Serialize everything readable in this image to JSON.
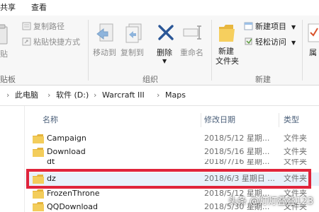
{
  "tabs": [
    "共享",
    "查看"
  ],
  "ribbon": {
    "clipboard": {
      "partial_paste": "贴",
      "copy_path": "复制路径",
      "paste_shortcut": "粘贴快捷方式",
      "group_label_partial": "贴板"
    },
    "organize": {
      "move_to": "移动到",
      "copy_to": "复制到",
      "delete": "删除",
      "rename": "重命名",
      "group_label": "组织"
    },
    "new": {
      "new_folder_line1": "新建",
      "new_folder_line2": "文件夹",
      "new_item": "新建项目",
      "easy_access": "轻松访问",
      "group_label": "新建"
    },
    "open": {
      "properties_partial": "属"
    }
  },
  "address": {
    "crumbs": [
      "此电脑",
      "软件 (D:)",
      "Warcraft III",
      "Maps"
    ]
  },
  "columns": {
    "name": "名称",
    "date": "修改日期",
    "type": "类型"
  },
  "files": [
    {
      "name": "Campaign",
      "date": "2018/5/12 星期...",
      "type": "文件夹"
    },
    {
      "name": "Download",
      "date": "2018/5/16 星期...",
      "type": "文件夹"
    },
    {
      "name": "dt",
      "date": "2018/7/16 星期...",
      "type": "文件夹"
    },
    {
      "name": "dz",
      "date": "2018/6/3 星期日 ...",
      "type": "文件夹"
    },
    {
      "name": "FrozenThrone",
      "date": "2018/5/12 星期...",
      "type": "文件夹"
    },
    {
      "name": "QQDownload",
      "date": "2018/5/30 星期...",
      "type": "文件夹"
    }
  ],
  "watermark": "头条 @灯灯叠叠123",
  "colors": {
    "highlight": "#e0243b",
    "folder": "#f3cd5b",
    "delete_x": "#2b5797",
    "ribbon_bg": "#f7f7f7"
  }
}
